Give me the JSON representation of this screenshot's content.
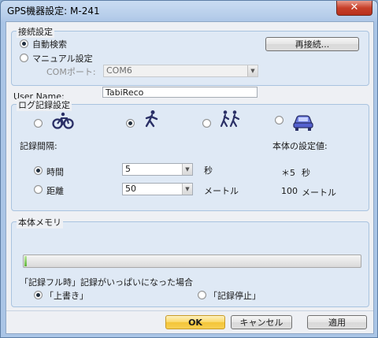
{
  "window": {
    "title": "GPS機器設定: M-241",
    "close_glyph": "✕"
  },
  "connection": {
    "group_label": "接続設定",
    "auto_label": "自動検索",
    "manual_label": "マニュアル設定",
    "reconnect_label": "再接続...",
    "com_port_label": "COMポート:",
    "com_port_value": "COM6",
    "selected": "auto"
  },
  "user": {
    "label": "User Name:",
    "value": "TabiReco"
  },
  "log": {
    "group_label": "ログ記録設定",
    "modes": [
      {
        "name": "bicycle",
        "icon": "bicycle-icon",
        "selected": false
      },
      {
        "name": "walk",
        "icon": "walker-icon",
        "selected": true
      },
      {
        "name": "hike",
        "icon": "hikers-icon",
        "selected": false
      },
      {
        "name": "car",
        "icon": "car-icon",
        "selected": false
      }
    ],
    "interval_label": "記録間隔:",
    "device_setting_label": "本体の設定値:",
    "time_label": "時間",
    "time_value": "5",
    "time_unit": "秒",
    "distance_label": "距離",
    "distance_value": "50",
    "distance_unit": "メートル",
    "device_time": "＊5",
    "device_time_unit": "秒",
    "device_distance": "100",
    "device_distance_unit": "メートル",
    "selected_interval": "time"
  },
  "memory": {
    "group_label": "本体メモリ",
    "usage_fraction": 0.008,
    "full_prompt": "「記録フル時」記録がいっぱいになった場合",
    "overwrite_label": "「上書き」",
    "stop_label": "「記録停止」",
    "selected": "overwrite"
  },
  "buttons": {
    "ok": "OK",
    "cancel": "キャンセル",
    "apply": "適用"
  },
  "colors": {
    "accent_ok": "#f4c538",
    "title_bg": "#b6cdea",
    "progress_fill": "#5fb63a"
  }
}
